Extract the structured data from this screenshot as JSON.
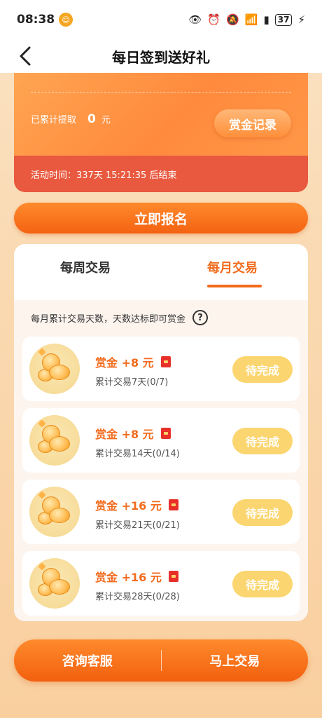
{
  "status_bar": {
    "time": "08:38",
    "battery": "37"
  },
  "nav": {
    "title": "每日签到送好礼"
  },
  "reward_card": {
    "withdraw_label": "已累计提取",
    "withdraw_amount": "0",
    "withdraw_unit": "元",
    "record_button": "赏金记录",
    "activity_text": "活动时间：337天 15:21:35 后结束"
  },
  "signup_button": "立即报名",
  "tabs": {
    "weekly": "每周交易",
    "monthly": "每月交易",
    "active": "monthly"
  },
  "task_desc": "每月累计交易天数，天数达标即可赏金",
  "help_icon_glyph": "?",
  "tasks": [
    {
      "reward": "赏金 +8 元",
      "detail": "累计交易7天(0/7)",
      "status": "待完成"
    },
    {
      "reward": "赏金 +8 元",
      "detail": "累计交易14天(0/14)",
      "status": "待完成"
    },
    {
      "reward": "赏金 +16 元",
      "detail": "累计交易21天(0/21)",
      "status": "待完成"
    },
    {
      "reward": "赏金 +16 元",
      "detail": "累计交易28天(0/28)",
      "status": "待完成"
    }
  ],
  "bottom_bar": {
    "consult": "咨询客服",
    "trade": "马上交易"
  },
  "colors": {
    "accent": "#f26b1d",
    "button_pending": "#fbd56f",
    "activity_bar": "#e8593f"
  }
}
